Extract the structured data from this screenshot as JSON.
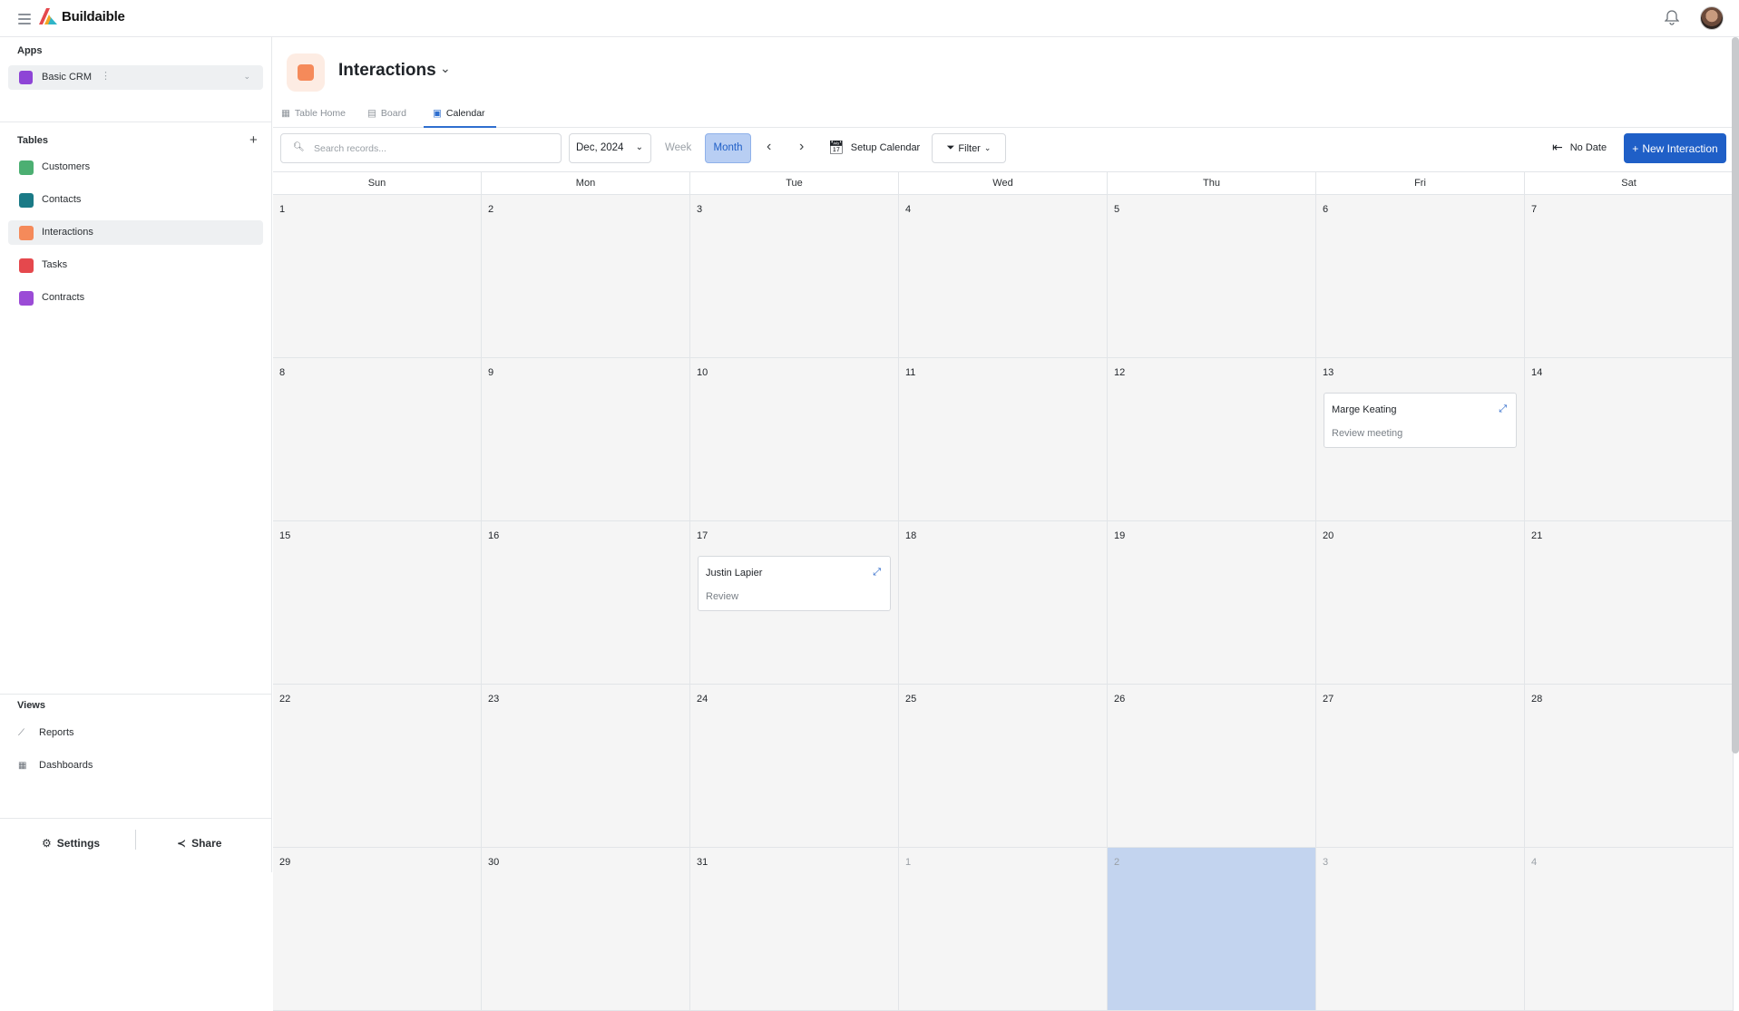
{
  "app": {
    "name": "Buildaible"
  },
  "sidebar": {
    "apps_title": "Apps",
    "app_item": {
      "label": "Basic CRM"
    },
    "tables_title": "Tables",
    "tables": [
      {
        "label": "Customers",
        "color": "#4caf72"
      },
      {
        "label": "Contacts",
        "color": "#1a7a86"
      },
      {
        "label": "Interactions",
        "color": "#f58a5a"
      },
      {
        "label": "Tasks",
        "color": "#e5484d"
      },
      {
        "label": "Contracts",
        "color": "#9b4bd6"
      }
    ],
    "views_title": "Views",
    "views": [
      {
        "label": "Reports",
        "icon": "line-chart-icon"
      },
      {
        "label": "Dashboards",
        "icon": "grid-icon"
      }
    ],
    "settings_label": "Settings",
    "share_label": "Share"
  },
  "header": {
    "title": "Interactions"
  },
  "tabs": [
    {
      "label": "Table Home"
    },
    {
      "label": "Board"
    },
    {
      "label": "Calendar",
      "active": true
    }
  ],
  "toolbar": {
    "search_placeholder": "Search records...",
    "date_value": "Dec, 2024",
    "week_label": "Week",
    "month_label": "Month",
    "setup_label": "Setup Calendar",
    "filter_label": "Filter",
    "no_date_label": "No Date",
    "new_label": "New Interaction"
  },
  "calendar": {
    "days_of_week": [
      "Sun",
      "Mon",
      "Tue",
      "Wed",
      "Thu",
      "Fri",
      "Sat"
    ],
    "weeks": [
      [
        "1",
        "2",
        "3",
        "4",
        "5",
        "6",
        "7"
      ],
      [
        "8",
        "9",
        "10",
        "11",
        "12",
        "13",
        "14"
      ],
      [
        "15",
        "16",
        "17",
        "18",
        "19",
        "20",
        "21"
      ],
      [
        "22",
        "23",
        "24",
        "25",
        "26",
        "27",
        "28"
      ],
      [
        "29",
        "30",
        "31",
        "1",
        "2",
        "3",
        "4"
      ]
    ],
    "today_cell": {
      "week": 4,
      "day": 4
    },
    "events": [
      {
        "week": 1,
        "day": 5,
        "name": "Marge Keating",
        "description": "Review meeting"
      },
      {
        "week": 2,
        "day": 2,
        "name": "Justin Lapier",
        "description": "Review"
      }
    ]
  },
  "colors": {
    "accent": "#1f5fc7",
    "month_selected_bg": "#b8cef3",
    "today_bg": "#c3d4ef",
    "interactions_icon": "#f58a5a"
  }
}
